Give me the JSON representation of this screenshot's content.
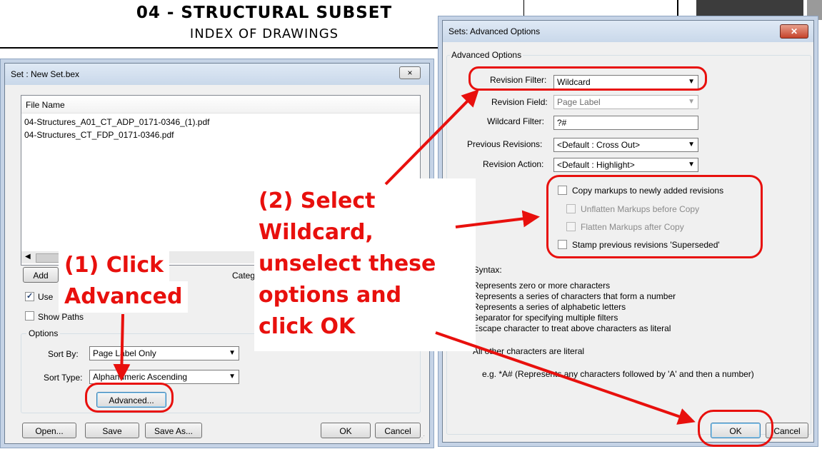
{
  "sheet": {
    "title": "04 - STRUCTURAL SUBSET",
    "subtitle": "INDEX OF DRAWINGS"
  },
  "set_dialog": {
    "title": "Set : New Set.bex",
    "close_label": "×",
    "file_list": {
      "header": "File Name",
      "files": [
        "04-Structures_A01_CT_ADP_0171-0346_(1).pdf",
        "04-Structures_CT_FDP_0171-0346.pdf"
      ]
    },
    "add_label": "Add",
    "category_label": "Categ",
    "use_checkbox_label": "Use",
    "use_checked": true,
    "show_paths_label": "Show Paths",
    "options_group": "Options",
    "sort_by_label": "Sort By:",
    "sort_by_value": "Page Label Only",
    "sort_type_label": "Sort Type:",
    "sort_type_value": "Alphanumeric Ascending",
    "advanced_label": "Advanced...",
    "open_label": "Open...",
    "save_label": "Save",
    "save_as_label": "Save As...",
    "ok_label": "OK",
    "cancel_label": "Cancel"
  },
  "adv_dialog": {
    "title": "Sets: Advanced Options",
    "close_label": "✕",
    "group_label": "Advanced Options",
    "revision_filter_label": "Revision Filter:",
    "revision_filter_value": "Wildcard",
    "revision_field_label": "Revision Field:",
    "revision_field_value": "Page Label",
    "wildcard_filter_label": "Wildcard Filter:",
    "wildcard_filter_value": "?#",
    "previous_revisions_label": "Previous Revisions:",
    "previous_revisions_value": "<Default : Cross Out>",
    "revision_action_label": "Revision Action:",
    "revision_action_value": "<Default : Highlight>",
    "copy_markups_label": "Copy markups to newly added revisions",
    "unflatten_label": "Unflatten Markups before Copy",
    "flatten_label": "Flatten Markups after Copy",
    "stamp_label": "Stamp previous revisions 'Superseded'",
    "syntax_heading": "ard Syntax:",
    "syntax_lines": [
      "Represents zero or more characters",
      "Represents a series of characters that form a number",
      "Represents a series of alphabetic letters",
      "Separator for specifying multiple filters",
      "Escape character to treat above characters as literal"
    ],
    "literal_note": "All other characters are literal",
    "example_note": "e.g. *A# (Represents any characters followed by 'A' and then a number)",
    "ok_label": "OK",
    "cancel_label": "Cancel"
  },
  "annotations": {
    "step1_line1": "(1) Click",
    "step1_line2": "Advanced",
    "step2_line1": "(2) Select",
    "step2_line2": "Wildcard,",
    "step2_line3": "unselect these",
    "step2_line4": "options and",
    "step2_line5": "click OK",
    "color": "#e8100d"
  }
}
